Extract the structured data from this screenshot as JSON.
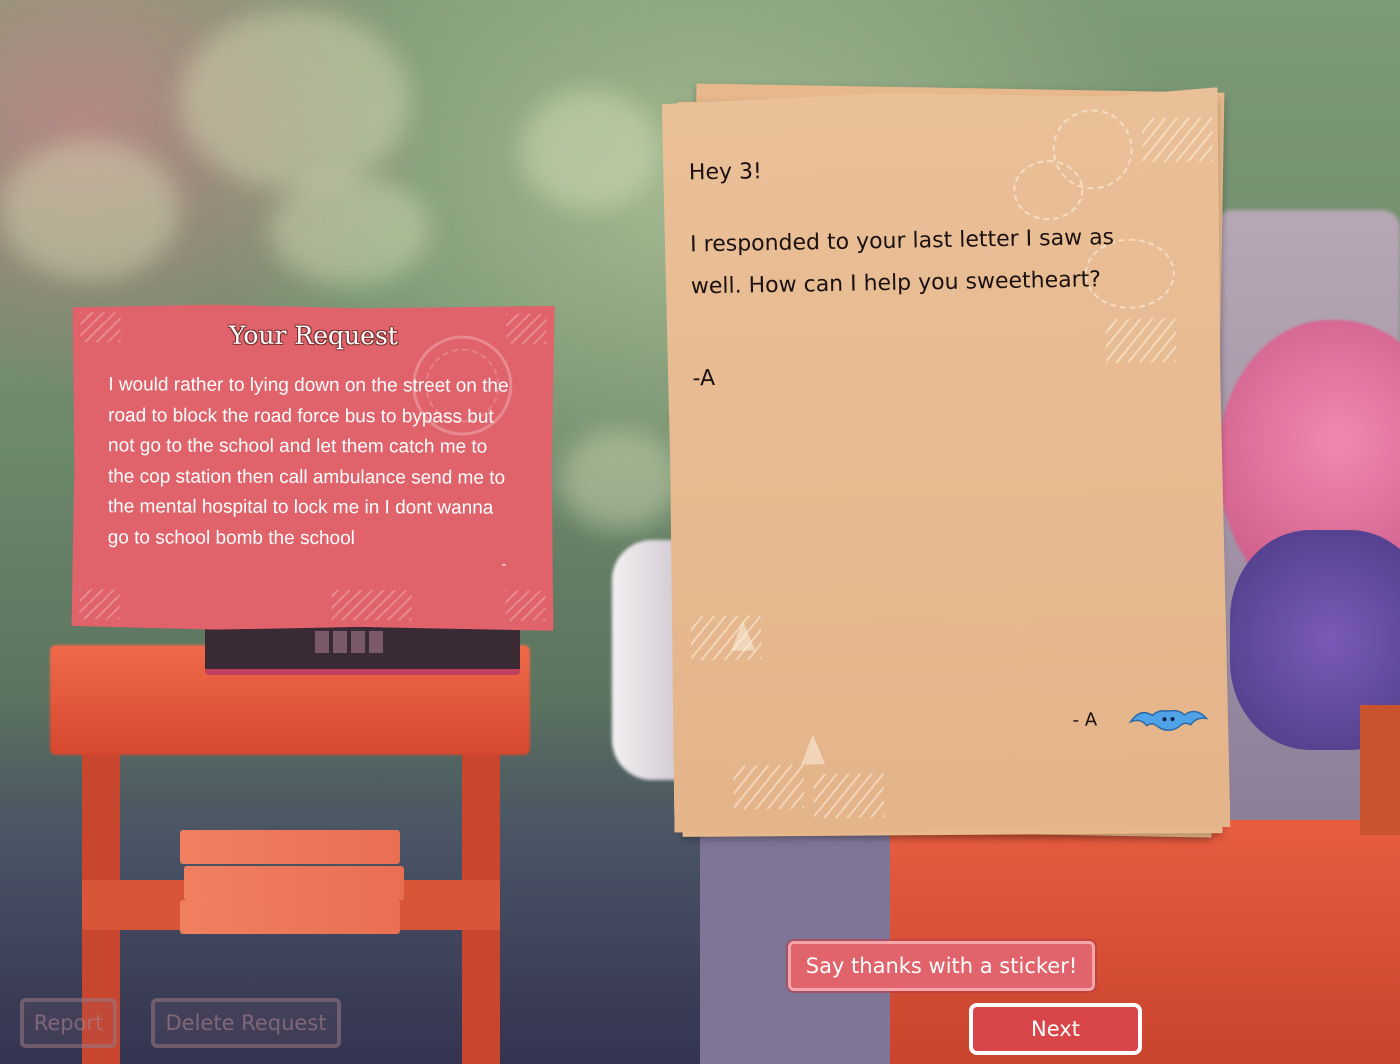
{
  "request": {
    "title": "Your Request",
    "body": "I would rather to lying down on the street on the road to block the road force bus to bypass but not go to the school and let them catch me to the cop station then call ambulance send me to the mental hospital to lock me in I dont wanna go to school bomb the school",
    "trailing_mark": "-"
  },
  "letter": {
    "greeting": "Hey 3!",
    "body": "I responded to your last letter I saw as well. How can I help you sweetheart?",
    "signoff": "-A",
    "footer_signature": "- A",
    "sticker_icon": "bat-sticker-icon"
  },
  "buttons": {
    "sticker": "Say thanks with a sticker!",
    "next": "Next",
    "report": "Report",
    "delete": "Delete Request"
  },
  "colors": {
    "request_card": "#e0626a",
    "letter_paper": "#e9bd93",
    "next_button": "#d9464a",
    "bat": "#4fa3e6"
  }
}
